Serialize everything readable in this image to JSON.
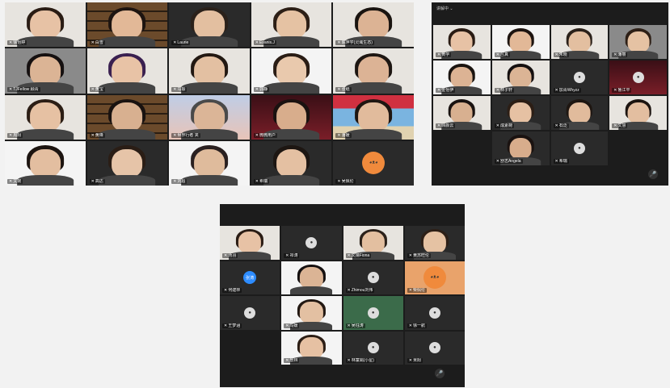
{
  "window1": {
    "tiles": [
      {
        "name": "徐怡婷",
        "bg": "light",
        "face": "#e7c2a5",
        "hair": "#2a1c14"
      },
      {
        "name": "白雪",
        "bg": "shelf",
        "face": "#e2b897",
        "hair": "#1d1410"
      },
      {
        "name": "Laurie",
        "bg": "dark",
        "face": "#e3bfa0",
        "hair": "#2b211a"
      },
      {
        "name": "Evanis.J",
        "bg": "light",
        "face": "#e5c2a3",
        "hair": "#2d1f16"
      },
      {
        "name": "陈萍学(灵域生态)",
        "bg": "light",
        "face": "#dcb394",
        "hair": "#1a1410"
      },
      {
        "name": "TJFellow 顾青",
        "bg": "grey",
        "face": "#dbb495",
        "hair": "#151010"
      },
      {
        "name": "黄宝",
        "bg": "light",
        "face": "#e8c3a6",
        "hair": "#3a2050"
      },
      {
        "name": "马振",
        "bg": "light",
        "face": "#e3c0a2",
        "hair": "#221812"
      },
      {
        "name": "郭静",
        "bg": "white",
        "face": "#e9c9ad",
        "hair": "#2a1d15"
      },
      {
        "name": "张纸",
        "bg": "light",
        "face": "#dcb395",
        "hair": "#1d1612"
      },
      {
        "name": "周阳",
        "bg": "light",
        "face": "#e6c1a3",
        "hair": "#2c1e15"
      },
      {
        "name": "黄锋",
        "bg": "shelf",
        "face": "#d8b090",
        "hair": "#191210"
      },
      {
        "name": "世界行者 夹",
        "bg": "sky",
        "face": "#dbb597",
        "hair": "#4a4a4a"
      },
      {
        "name": "微微用户",
        "bg": "red",
        "face": "#d8ad8c",
        "hair": "#1a1210"
      },
      {
        "name": "潘媛",
        "bg": "beach",
        "face": "#e1bb9c",
        "hair": "#1e1611"
      },
      {
        "name": "文婉",
        "bg": "white",
        "face": "#e3bea0",
        "hair": "#1c1410"
      },
      {
        "name": "高达",
        "bg": "dark",
        "face": "#e6c4a8",
        "hair": "#2a1d15"
      },
      {
        "name": "刘超",
        "bg": "white",
        "face": "#dfbb9c",
        "hair": "#2a2020"
      },
      {
        "name": "希瑞",
        "bg": "dark",
        "face": "#e4c0a2",
        "hair": "#1d1612"
      },
      {
        "name": "吴佩伦",
        "bg": "dark",
        "face": "",
        "hair": "",
        "avatar": "orange"
      }
    ]
  },
  "window2": {
    "topbar": "讲解中 ⌄",
    "tiles": [
      {
        "name": "黄学",
        "bg": "light",
        "face": "#e7c2a5",
        "hair": "#2a1c14"
      },
      {
        "name": "吕真",
        "bg": "white",
        "face": "#e2b897",
        "hair": "#1d1410"
      },
      {
        "name": "朱晓",
        "bg": "light",
        "face": "#e3bfa0",
        "hair": "#2b211a"
      },
      {
        "name": "潘丽",
        "bg": "grey",
        "face": "#e5c2a3",
        "hair": "#2d1f16"
      },
      {
        "name": "金怡伊",
        "bg": "white",
        "face": "#dcb394",
        "hair": "#1a1410"
      },
      {
        "name": "林子轩",
        "bg": "light",
        "face": "#dbb495",
        "hair": "#151010"
      },
      {
        "name": "加青Whyzz",
        "bg": "dark",
        "face": "",
        "hair": "",
        "avatar": "grey"
      },
      {
        "name": "鲁江平",
        "bg": "red",
        "face": "",
        "hair": "",
        "avatar": "grey"
      },
      {
        "name": "顾颜云",
        "bg": "light",
        "face": "#d8b090",
        "hair": "#191210"
      },
      {
        "name": "成素荷",
        "bg": "dark",
        "face": "#e6c1a3",
        "hair": "#2c1e15"
      },
      {
        "name": "石泛",
        "bg": "dark",
        "face": "#e1bb9c",
        "hair": "#1e1611"
      },
      {
        "name": "文慧",
        "bg": "light",
        "face": "#e3bea0",
        "hair": "#1c1410"
      },
      {
        "name": "",
        "bg": "empty",
        "face": "",
        "hair": ""
      },
      {
        "name": "舒志Angela",
        "bg": "dark",
        "face": "#d8ad8c",
        "hair": "#1a1210"
      },
      {
        "name": "希瑞",
        "bg": "dark",
        "face": "",
        "hair": "",
        "avatar": "grey"
      },
      {
        "name": "",
        "bg": "empty",
        "face": "",
        "hair": ""
      }
    ]
  },
  "window3": {
    "tiles": [
      {
        "name": "汤羽",
        "bg": "light",
        "face": "#e7c2a5",
        "hair": "#2a1c14"
      },
      {
        "name": "祁涛",
        "bg": "dark",
        "face": "",
        "hair": "",
        "avatar": "grey"
      },
      {
        "name": "文婧Fiona",
        "bg": "light",
        "face": "#e3bfa0",
        "hair": "#2b211a"
      },
      {
        "name": "黄苏旺伦",
        "bg": "dark",
        "face": "#e5c2a3",
        "hair": "#2d1f16"
      },
      {
        "name": "何建林",
        "bg": "dark",
        "face": "",
        "hair": "",
        "avatar": "blue",
        "avatar_text": "张涛"
      },
      {
        "name": "",
        "bg": "white",
        "face": "#dbb495",
        "hair": "#151010"
      },
      {
        "name": "Zhimou刘伟",
        "bg": "dark",
        "face": "",
        "hair": "",
        "avatar": "grey"
      },
      {
        "name": "柴佩伦",
        "bg": "orangebg",
        "face": "",
        "hair": "",
        "avatar": "orange"
      },
      {
        "name": "王梦涵",
        "bg": "dark",
        "face": "",
        "hair": "",
        "avatar": "grey"
      },
      {
        "name": "冯媛",
        "bg": "white",
        "face": "#e3c0a2",
        "hair": "#221812"
      },
      {
        "name": "吴钰涛",
        "bg": "green",
        "face": "",
        "hair": "",
        "avatar": "grey"
      },
      {
        "name": "徐一航",
        "bg": "dark",
        "face": "",
        "hair": "",
        "avatar": "grey"
      },
      {
        "name": "",
        "bg": "empty",
        "face": "",
        "hair": ""
      },
      {
        "name": "景林",
        "bg": "white",
        "face": "#e6c1a3",
        "hair": "#2c1e15"
      },
      {
        "name": "林童娟(小星)",
        "bg": "dark",
        "face": "",
        "hair": "",
        "avatar": "grey"
      },
      {
        "name": "米阳",
        "bg": "dark",
        "face": "",
        "hair": "",
        "avatar": "grey"
      }
    ]
  },
  "colors": {
    "window_bg": "#1c1c1c",
    "page_bg": "#f2f2f2",
    "accent": "#2d8cff"
  }
}
